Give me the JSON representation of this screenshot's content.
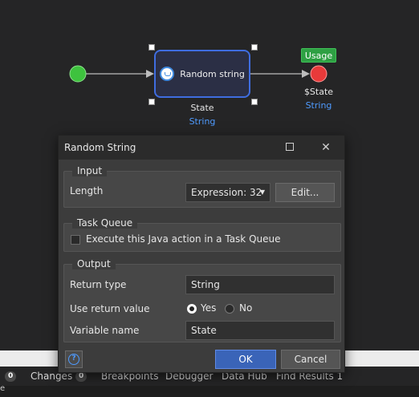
{
  "flow": {
    "activity_label": "Random string",
    "activity_output_name": "State",
    "activity_output_type": "String",
    "end_variable": "$State",
    "end_type": "String",
    "usage_badge": "Usage",
    "colors": {
      "start": "#3ec23e",
      "end": "#e83a3a",
      "accent": "#3f6de0"
    }
  },
  "dialog": {
    "title": "Random String",
    "input_group": {
      "title": "Input",
      "length_label": "Length",
      "length_value": "Expression: 32",
      "edit_button": "Edit..."
    },
    "task_queue_group": {
      "title": "Task Queue",
      "checkbox_label": "Execute this Java action in a Task Queue",
      "checked": false
    },
    "output_group": {
      "title": "Output",
      "return_type_label": "Return type",
      "return_type_value": "String",
      "use_return_label": "Use return value",
      "yes_label": "Yes",
      "no_label": "No",
      "selected": "Yes",
      "variable_name_label": "Variable name",
      "variable_name_value": "State"
    },
    "ok_button": "OK",
    "cancel_button": "Cancel"
  },
  "bottom_tabs": {
    "first_count": "0",
    "changes": "Changes",
    "changes_count": "0",
    "breakpoints": "Breakpoints",
    "debugger": "Debugger",
    "data_hub": "Data Hub",
    "find_results": "Find Results 1"
  },
  "bottom_strip_text": "e"
}
